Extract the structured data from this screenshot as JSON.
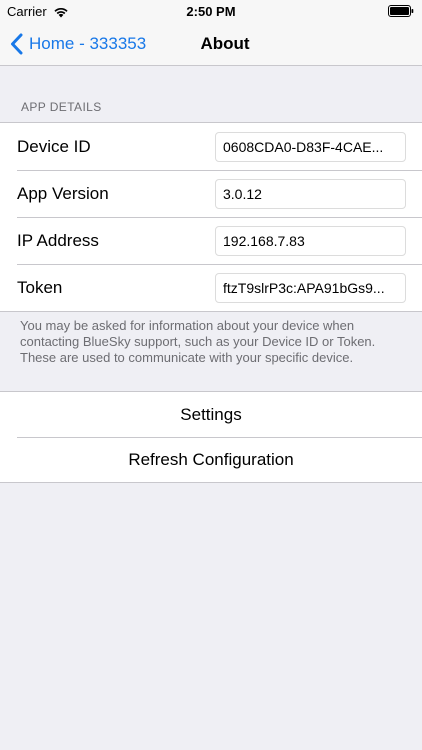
{
  "status_bar": {
    "carrier": "Carrier",
    "time": "2:50 PM",
    "wifi_icon": "wifi-icon",
    "battery_icon": "battery-icon"
  },
  "nav": {
    "back_label": "Home - 333353",
    "title": "About",
    "accent_color": "#1878e8"
  },
  "app_details": {
    "header": "APP DETAILS",
    "rows": [
      {
        "label": "Device ID",
        "value": "0608CDA0-D83F-4CAE..."
      },
      {
        "label": "App Version",
        "value": "3.0.12"
      },
      {
        "label": "IP Address",
        "value": "192.168.7.83"
      },
      {
        "label": "Token",
        "value": "ftzT9slrP3c:APA91bGs9..."
      }
    ],
    "footer": "You may be asked for information about your device when contacting BlueSky support, such as your Device ID or Token. These are used to communicate with your specific device."
  },
  "actions": {
    "settings": "Settings",
    "refresh": "Refresh Configuration"
  }
}
